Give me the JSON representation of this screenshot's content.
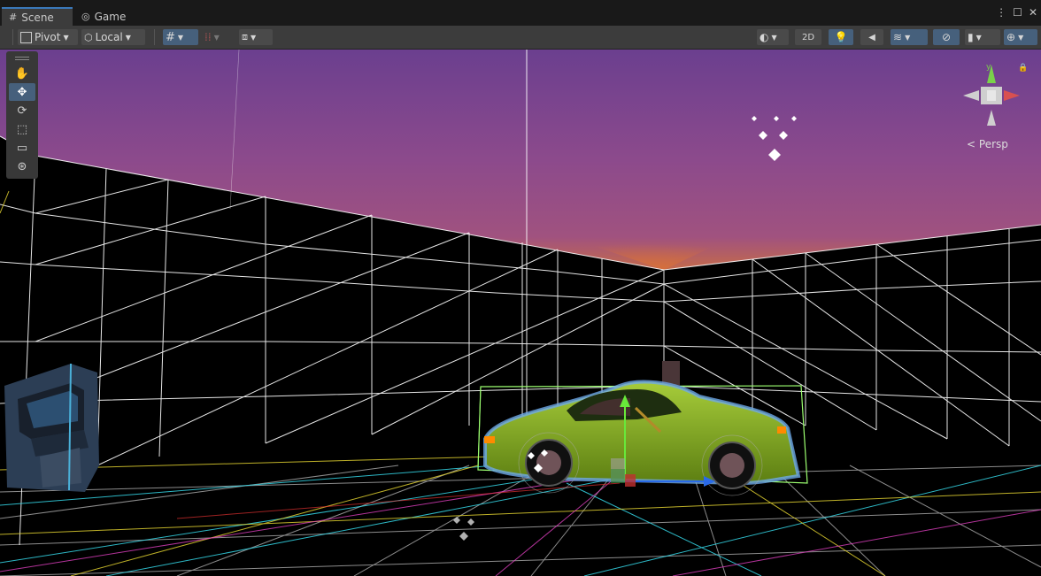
{
  "tabs": [
    {
      "label": "Scene",
      "icon": "#"
    },
    {
      "label": "Game",
      "icon": "◎"
    }
  ],
  "window_controls": [
    "⋮",
    "☐",
    "✕"
  ],
  "toolbar": {
    "pivot_label": "Pivot",
    "local_label": "Local",
    "twod_label": "2D"
  },
  "tools": [
    "hand-tool",
    "move-tool",
    "rotate-tool",
    "scale-tool",
    "rect-tool",
    "transform-tool"
  ],
  "view": {
    "projection_label": "Persp"
  },
  "colors": {
    "sky_top": "#6b3f8f",
    "sky_mid": "#a0527f",
    "sky_horizon": "#c46a4a",
    "car_body": "#8fb82a",
    "accent_blue": "#46607c"
  }
}
